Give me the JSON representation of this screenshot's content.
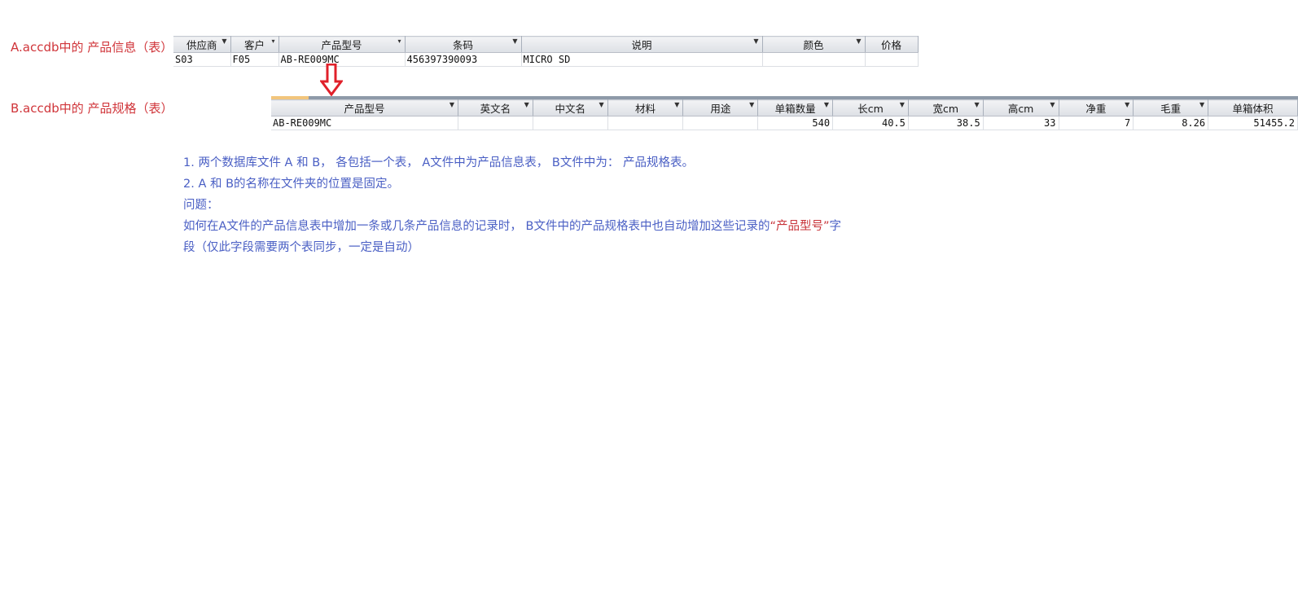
{
  "labels": {
    "table_a": "A.accdb中的 产品信息（表）",
    "table_b": "B.accdb中的 产品规格（表）"
  },
  "table_a": {
    "columns": [
      "供应商",
      "客户",
      "产品型号",
      "条码",
      "说明",
      "颜色",
      "价格"
    ],
    "row": [
      "S03",
      "F05",
      "AB-RE009MC",
      "456397390093",
      "MICRO SD",
      "",
      ""
    ]
  },
  "table_b": {
    "columns": [
      "产品型号",
      "英文名",
      "中文名",
      "材料",
      "用途",
      "单箱数量",
      "长cm",
      "宽cm",
      "高cm",
      "净重",
      "毛重",
      "单箱体积"
    ],
    "row": [
      "AB-RE009MC",
      "",
      "",
      "",
      "",
      "540",
      "40.5",
      "38.5",
      "33",
      "7",
      "8.26",
      "51455.2"
    ]
  },
  "notes": {
    "line1": "1. 两个数据库文件 A  和 B， 各包括一个表， A文件中为产品信息表， B文件中为： 产品规格表。",
    "line2": "2. A 和 B的名称在文件夹的位置是固定。",
    "line3": "问题：",
    "line4_a": "如何在A文件的产品信息表中增加一条或几条产品信息的记录时， B文件中的产品规格表中也自动增加这些记录的",
    "line4_b": "“产品型号”",
    "line4_c": "字",
    "line5": "段（仅此字段需要两个表同步，一定是自动）"
  },
  "colors": {
    "label": "#d0353a",
    "notes": "#4a5fc4",
    "highlight": "#c8343a",
    "arrow": "#e0202a"
  }
}
